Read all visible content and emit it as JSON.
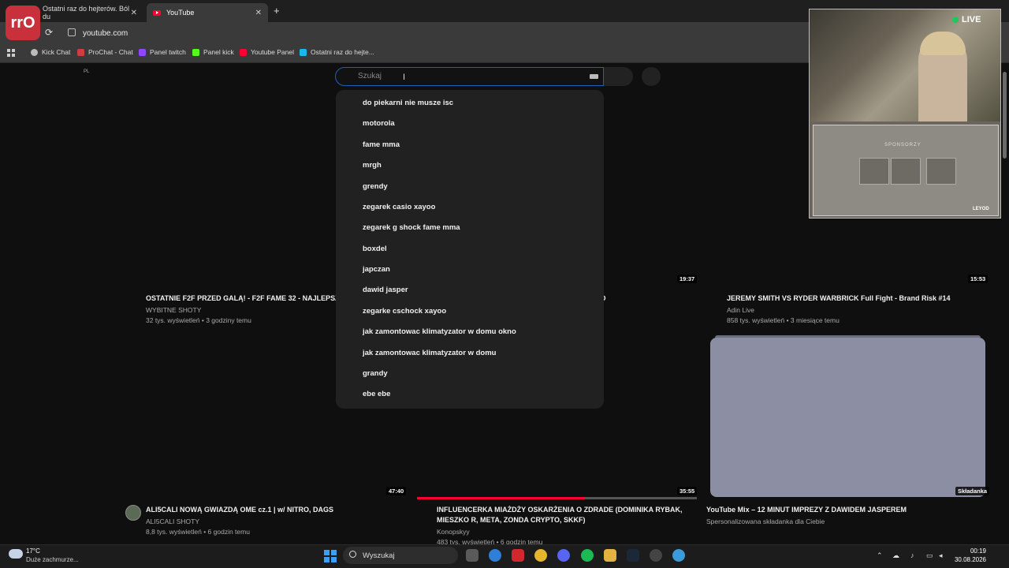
{
  "browser": {
    "tabs": [
      {
        "title": "Ostatni raz do hejterów. Ból du",
        "close": "✕"
      },
      {
        "title": "YouTube",
        "close": "✕"
      }
    ],
    "new_tab": "+",
    "logo_text": "rrO",
    "reload": "⟳",
    "url": "youtube.com",
    "bookmarks": [
      {
        "label": "Kick Chat",
        "color": "#bbbbbb"
      },
      {
        "label": "ProChat - Chat",
        "color": "#d23c3c"
      },
      {
        "label": "Panel twitch",
        "color": "#9146ff"
      },
      {
        "label": "Panel kick",
        "color": "#53fc18"
      },
      {
        "label": "Youtube Panel",
        "color": "#ff0033"
      },
      {
        "label": "Ostatni raz do hejte...",
        "color": "#1ab7ea"
      }
    ]
  },
  "youtube": {
    "country_code": "PL",
    "search": {
      "placeholder": "Szukaj",
      "cursor": "I",
      "suggestions": [
        "do piekarni nie musze isc",
        "motorola",
        "fame mma",
        "mrgh",
        "grendy",
        "zegarek casio xayoo",
        "zegarek g shock fame mma",
        "boxdel",
        "japczan",
        "dawid jasper",
        "zegarke cschock xayoo",
        "jak zamontowac klimatyzator w domu okno",
        "jak zamontowac klimatyzator w domu",
        "grandy",
        "ebe ebe"
      ]
    },
    "videos_row1": [
      {
        "title": "OSTATNIE F2F PRZED GALĄ! - F2F FAME 32 - NAJLEPSZ",
        "channel": "WYBITNE SHOTY",
        "meta": "32 tys. wyświetleń • 3 godziny temu"
      },
      {
        "title_tail": "D",
        "duration": "19:37"
      },
      {
        "title": "JEREMY SMITH VS RYDER WARBRICK Full Fight - Brand Risk #14",
        "channel": "Adin Live",
        "meta": "858 tys. wyświetleń • 3 miesiące temu",
        "duration": "15:53"
      }
    ],
    "videos_row2": [
      {
        "title": "ALI5CALI NOWĄ GWIAZDĄ OME cz.1 | w/ NITRO, DAGS",
        "channel": "ALI5CALI SHOTY",
        "meta": "8,8 tys. wyświetleń • 6 godzin temu",
        "duration": "47:40"
      },
      {
        "title_line1": "INFLUENCERKA MIAŻDŻY OSKARŻENIA O ZDRADE (DOMINIKA RYBAK,",
        "title_line2": "MIESZKO R, META, ZONDA CRYPTO, SKKF)",
        "channel": "Konopskyy",
        "meta": "483 tys. wyświetleń • 6 godzin temu",
        "duration": "35:55",
        "watched_fraction": 0.6
      },
      {
        "title": "YouTube Mix – 12 MINUT IMPREZY Z DAWIDEM JASPEREM",
        "channel": "Spersonalizowana składanka dla Ciebie",
        "badge": "Składanka"
      }
    ]
  },
  "stream_overlay": {
    "live_label": "LIVE",
    "sponsors_label": "SPONSORZY",
    "corner_label": "LEYOD"
  },
  "taskbar": {
    "temperature": "17°C",
    "weather": "Duże zachmurze...",
    "search_label": "Wyszukaj",
    "time": "00:19",
    "date": "30.08.2026",
    "tray_icons": [
      "chevron-up-icon",
      "cloud-icon",
      "microphone-icon",
      "network-icon",
      "volume-icon",
      "battery-icon"
    ],
    "apps": [
      {
        "name": "task-view-icon",
        "color": "#5a5a5a"
      },
      {
        "name": "edge-icon",
        "color": "#2f7fd8"
      },
      {
        "name": "acrobat-icon",
        "color": "#d0282e"
      },
      {
        "name": "chrome-icon",
        "color": "#e5b52c"
      },
      {
        "name": "discord-icon",
        "color": "#5865f2"
      },
      {
        "name": "spotify-icon",
        "color": "#1db954"
      },
      {
        "name": "folder-icon",
        "color": "#e3b341"
      },
      {
        "name": "steam-icon",
        "color": "#1b2838"
      },
      {
        "name": "obs-icon",
        "color": "#444444"
      },
      {
        "name": "globe-icon",
        "color": "#3b9ad9"
      }
    ]
  }
}
